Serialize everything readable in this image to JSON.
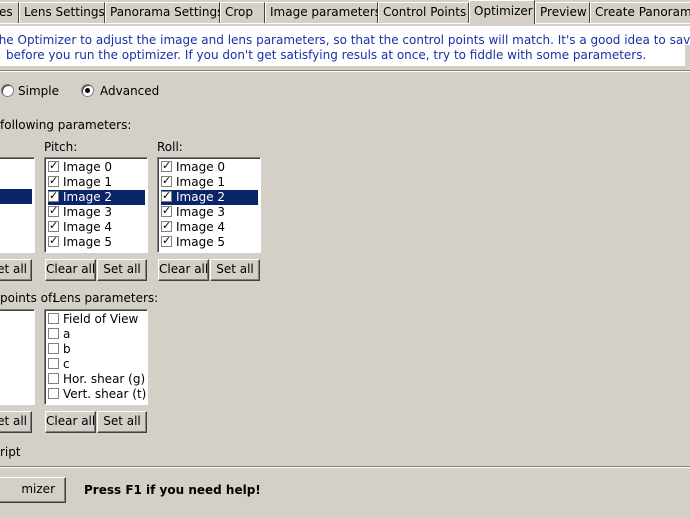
{
  "tabs": [
    {
      "label": "es",
      "active": false
    },
    {
      "label": "Lens Settings",
      "active": false
    },
    {
      "label": "Panorama Settings",
      "active": false
    },
    {
      "label": "Crop",
      "active": false
    },
    {
      "label": "Image parameters",
      "active": false
    },
    {
      "label": "Control Points",
      "active": false
    },
    {
      "label": "Optimizer",
      "active": true
    },
    {
      "label": "Preview",
      "active": false
    },
    {
      "label": "Create Panorama",
      "active": false
    }
  ],
  "description": {
    "line1": "the Optimizer to adjust the image and lens parameters, so that the control points will match. It's a good idea to save",
    "line2": "before you run the optimizer. If you don't get satisfying resuls at once, try to fiddle with some parameters."
  },
  "mode": {
    "simple_label": "Simple",
    "advanced_label": "Advanced",
    "selected": "Advanced"
  },
  "params_heading": "following parameters:",
  "pitch": {
    "label": "Pitch:",
    "items": [
      "Image 0",
      "Image 1",
      "Image 2",
      "Image 3",
      "Image 4",
      "Image 5"
    ],
    "selected_index": 2,
    "clear_label": "Clear all",
    "set_label": "Set all"
  },
  "roll": {
    "label": "Roll:",
    "items": [
      "Image 0",
      "Image 1",
      "Image 2",
      "Image 3",
      "Image 4",
      "Image 5"
    ],
    "selected_index": 2,
    "clear_label": "Clear all",
    "set_label": "Set all"
  },
  "left_partial": {
    "set_label": "et all",
    "set_label2": "et all"
  },
  "points_of_label": "points of:",
  "lens": {
    "label": "Lens parameters:",
    "items": [
      "Field of View",
      "a",
      "b",
      "c",
      "Hor. shear (g)",
      "Vert. shear (t)"
    ],
    "clear_label": "Clear all",
    "set_label": "Set all"
  },
  "script_label": "ript",
  "optimize_button": "mizer",
  "help_text": "Press F1 if you need help!"
}
